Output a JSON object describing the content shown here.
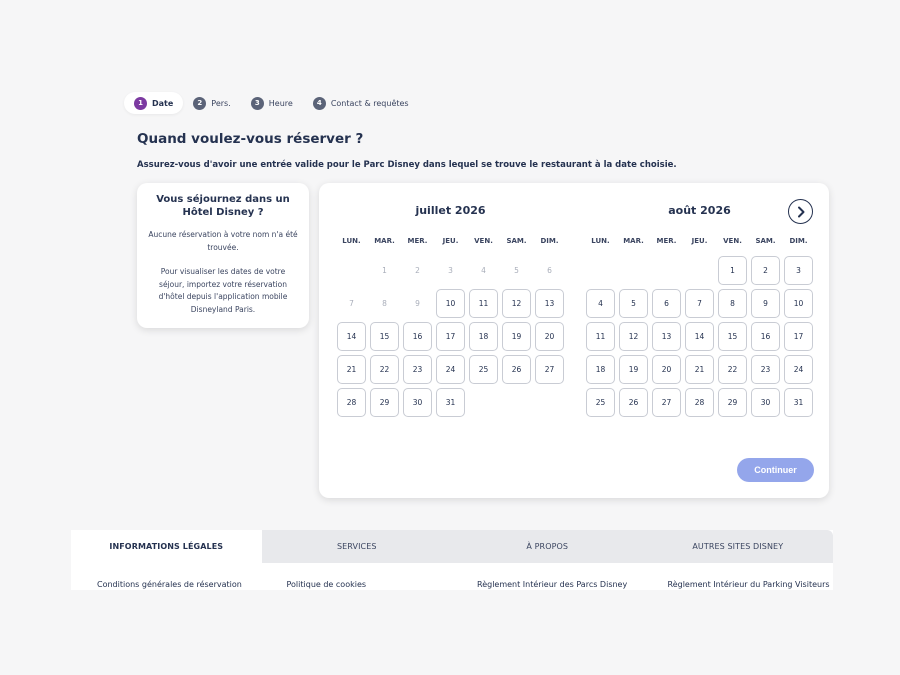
{
  "steps": [
    {
      "num": "1",
      "label": "Date",
      "active": true
    },
    {
      "num": "2",
      "label": "Pers.",
      "active": false
    },
    {
      "num": "3",
      "label": "Heure",
      "active": false
    },
    {
      "num": "4",
      "label": "Contact & requêtes",
      "active": false
    }
  ],
  "page": {
    "title": "Quand voulez-vous réserver ?",
    "subtitle": "Assurez-vous d'avoir une entrée valide pour le Parc Disney dans lequel se trouve le restaurant à la date choisie."
  },
  "hotel": {
    "title": "Vous séjournez dans un Hôtel Disney ?",
    "no_booking": "Aucune réservation à votre nom n'a été trouvée.",
    "instructions": "Pour visualiser les dates de votre séjour, importez votre réservation d'hôtel depuis l'application mobile Disneyland Paris."
  },
  "calendar": {
    "weekdays": [
      "LUN.",
      "MAR.",
      "MER.",
      "JEU.",
      "VEN.",
      "SAM.",
      "DIM."
    ],
    "months": [
      {
        "title": "juillet 2026",
        "first_weekday": 2,
        "days_in_month": 31,
        "disabled_until": 9
      },
      {
        "title": "août 2026",
        "first_weekday": 5,
        "days_in_month": 31,
        "disabled_until": 0
      }
    ],
    "next_icon": "chevron-right-icon",
    "continue_label": "Continuer"
  },
  "footer": {
    "tabs": [
      {
        "label": "INFORMATIONS LÉGALES",
        "active": true
      },
      {
        "label": "SERVICES",
        "active": false
      },
      {
        "label": "À PROPOS",
        "active": false
      },
      {
        "label": "AUTRES SITES DISNEY",
        "active": false
      }
    ],
    "links": [
      "Conditions générales de réservation",
      "Politique de cookies",
      "Règlement Intérieur des Parcs Disney",
      "Règlement Intérieur du Parking Visiteurs"
    ]
  },
  "colors": {
    "accent": "#7c3aa1",
    "button": "#94a6eb",
    "text": "#253250"
  }
}
